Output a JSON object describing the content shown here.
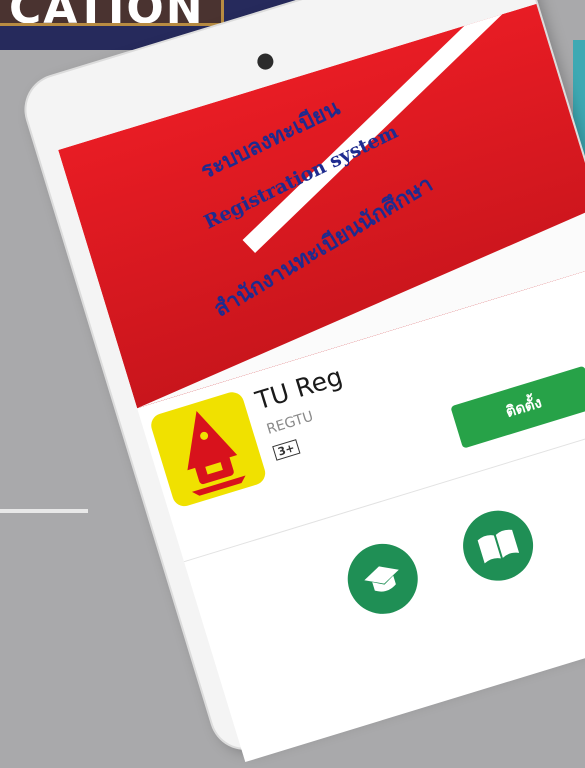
{
  "banner": {
    "text": "CATION"
  },
  "hero": {
    "title_thai": "ระบบลงทะเบียน",
    "title_en": "Registration system",
    "subtitle_thai": "สำนักงานทะเบียนนักศึกษา"
  },
  "app": {
    "name": "TU Reg",
    "developer": "REGTU",
    "content_rating": "3+",
    "install_label": "ติดตั้ง"
  },
  "icons": {
    "app_icon": "tu-emblem-icon",
    "category_1": "graduation-cap-icon",
    "category_2": "book-icon"
  },
  "colors": {
    "hero_red": "#e81c24",
    "hero_text": "#1e2b8f",
    "install_green": "#27a248",
    "app_icon_bg": "#f0e100",
    "banner_navy": "#262a5c"
  }
}
